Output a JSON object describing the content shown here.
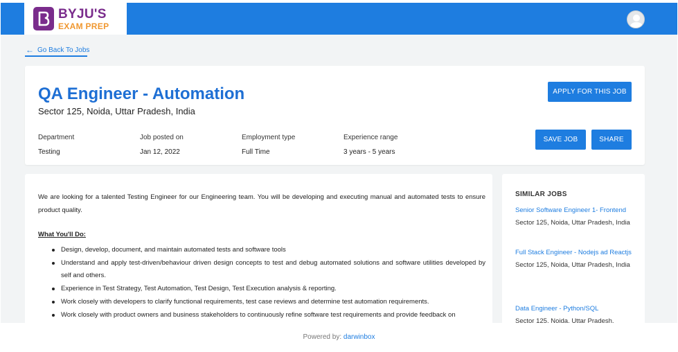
{
  "header": {
    "logo": {
      "line1": "BYJU'S",
      "line2": "EXAM PREP",
      "color": "#7a2c8c",
      "accent": "#f0972f"
    },
    "avatar_icon": "user-avatar-icon",
    "bar_color": "#1e7de0"
  },
  "nav": {
    "back_label": "Go Back To Jobs",
    "back_icon": "arrow-left-icon"
  },
  "job": {
    "title": "QA Engineer - Automation",
    "location": "Sector 125, Noida, Uttar Pradesh, India",
    "meta": [
      {
        "label": "Department",
        "value": "Testing"
      },
      {
        "label": "Job posted on",
        "value": "Jan 12, 2022"
      },
      {
        "label": "Employment type",
        "value": "Full Time"
      },
      {
        "label": "Experience range",
        "value": "3 years - 5 years"
      }
    ],
    "actions": {
      "apply": "APPLY FOR THIS JOB",
      "save": "SAVE JOB",
      "share": "SHARE"
    }
  },
  "description": {
    "intro": "We are looking for a talented  Testing Engineer for our Engineering team. You will be developing and executing manual and automated tests to ensure product quality.",
    "heading": "What You'll Do:",
    "bullets": [
      "Design, develop, document, and maintain automated tests and software tools",
      "Understand and apply test-driven/behaviour driven design concepts to test and debug automated solutions and software utilities developed by self and others.",
      "Experience in Test Strategy, Test Automation, Test Design, Test Execution analysis & reporting.",
      "Work closely with developers to clarify functional requirements, test case reviews and determine test automation requirements.",
      "Work closely with product owners and business stakeholders to continuously refine software test requirements and provide feedback on"
    ]
  },
  "similar_jobs": {
    "heading": "SIMILAR JOBS",
    "items": [
      {
        "title": "Senior Software Engineer 1- Frontend",
        "location": "Sector 125, Noida, Uttar Pradesh, India"
      },
      {
        "title": "Full Stack Engineer - Nodejs ad Reactjs",
        "location": "Sector 125, Noida, Uttar Pradesh, India"
      },
      {
        "title": "Data Engineer - Python/SQL",
        "location": "Sector 125, Noida, Uttar Pradesh,"
      }
    ]
  },
  "footer": {
    "prefix": "Powered by:",
    "brand": "darwinbox"
  }
}
